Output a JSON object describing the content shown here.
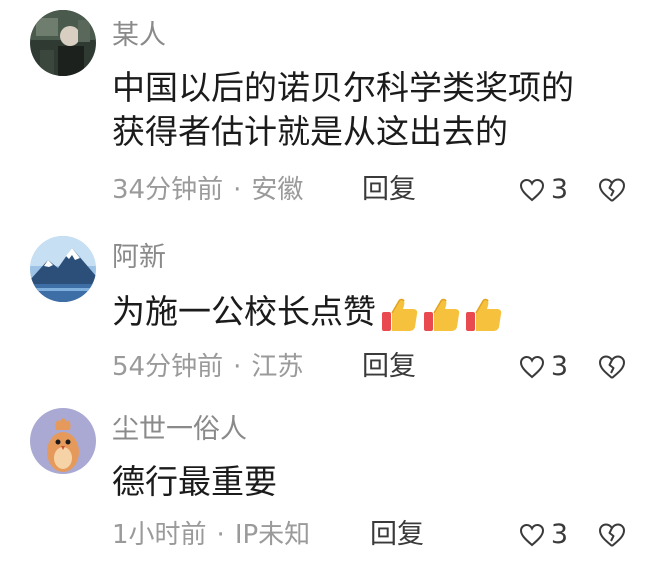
{
  "comments": [
    {
      "username": "某人",
      "lines": [
        "中国以后的诺贝尔科学类奖项的",
        "获得者估计就是从这出去的"
      ],
      "time": "34分钟前",
      "location": "安徽",
      "reply_label": "回复",
      "likes": "3",
      "avatar_icon": "dark-portrait-avatar"
    },
    {
      "username": "阿新",
      "lines": [
        "为施一公校长点赞"
      ],
      "emojis": [
        "thumbs-up-icon",
        "thumbs-up-icon",
        "thumbs-up-icon"
      ],
      "time": "54分钟前",
      "location": "江苏",
      "reply_label": "回复",
      "likes": "3",
      "avatar_icon": "snowy-mountain-avatar"
    },
    {
      "username": "尘世一俗人",
      "lines": [
        "德行最重要"
      ],
      "time": "1小时前",
      "location": "IP未知",
      "reply_label": "回复",
      "likes": "3",
      "avatar_icon": "cartoon-bird-avatar"
    }
  ],
  "separator": "·",
  "colors": {
    "text": "#1b1b1b",
    "muted": "#9a9a9a",
    "username": "#8a8a8a"
  }
}
